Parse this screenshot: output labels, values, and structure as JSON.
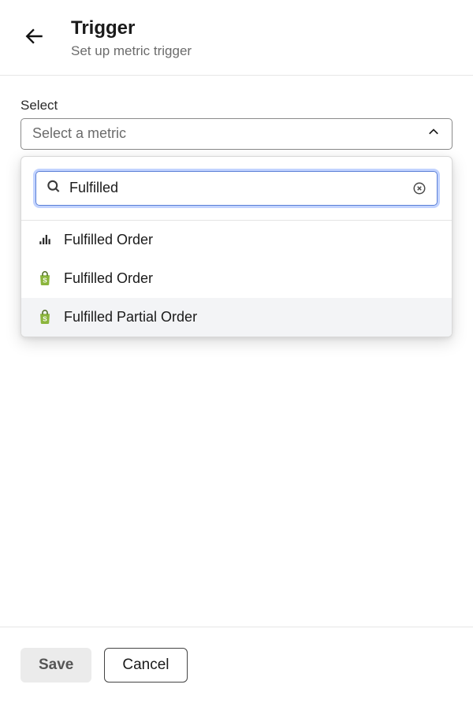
{
  "header": {
    "title": "Trigger",
    "subtitle": "Set up metric trigger"
  },
  "field": {
    "label": "Select",
    "placeholder": "Select a metric"
  },
  "search": {
    "value": "Fulfilled"
  },
  "options": [
    {
      "label": "Fulfilled Order",
      "icon": "metric"
    },
    {
      "label": "Fulfilled Order",
      "icon": "shopping-bag"
    },
    {
      "label": "Fulfilled Partial Order",
      "icon": "shopping-bag",
      "hover": true
    }
  ],
  "footer": {
    "save": "Save",
    "cancel": "Cancel"
  }
}
